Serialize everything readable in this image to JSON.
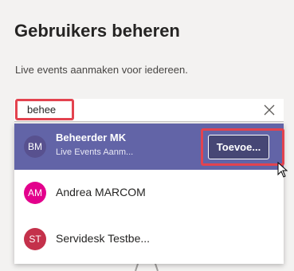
{
  "panel": {
    "title": "Gebruikers beheren",
    "subtitle": "Live events aanmaken voor iedereen."
  },
  "search": {
    "value": "behee"
  },
  "results": [
    {
      "initials": "BM",
      "name": "Beheerder MK",
      "subtitle": "Live Events Aanm...",
      "avatar_color": "#58518f",
      "add_label": "Toevoe..."
    },
    {
      "initials": "AM",
      "name": "Andrea MARCOM",
      "avatar_color": "#e3008c"
    },
    {
      "initials": "ST",
      "name": "Servidesk Testbe...",
      "avatar_color": "#c4314b"
    }
  ],
  "colors": {
    "selected_row": "#6264a7",
    "highlight": "#e3434f"
  }
}
